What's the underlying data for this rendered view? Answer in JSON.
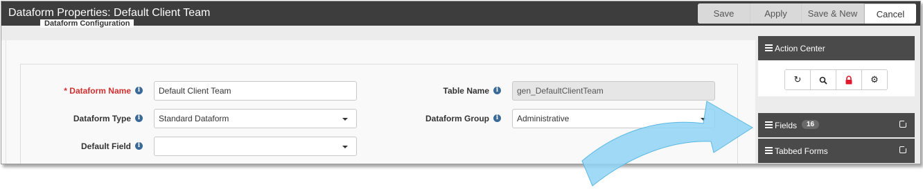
{
  "window": {
    "title": "Dataform Properties: Default Client Team",
    "buttons": {
      "save": "Save",
      "apply": "Apply",
      "save_new": "Save & New",
      "cancel": "Cancel"
    }
  },
  "form": {
    "section_title": "Dataform Configuration",
    "dataform_name": {
      "label": "* Dataform Name",
      "value": "Default Client Team"
    },
    "dataform_type": {
      "label": "Dataform Type",
      "value": "Standard Dataform"
    },
    "default_field": {
      "label": "Default Field",
      "value": ""
    },
    "table_name": {
      "label": "Table Name",
      "value": "gen_DefaultClientTeam"
    },
    "dataform_group": {
      "label": "Dataform Group",
      "value": "Administrative"
    }
  },
  "sidebar": {
    "action_center": {
      "label": "Action Center",
      "icons": [
        "refresh-icon",
        "search-icon",
        "lock-icon",
        "gear-icon"
      ]
    },
    "fields": {
      "label": "Fields",
      "count": "16"
    },
    "tabbed_forms": {
      "label": "Tabbed Forms"
    }
  },
  "colors": {
    "titlebar": "#3d3d3d",
    "required": "#d32f2f",
    "arrow": "#8fd3f4",
    "lock": "#e0192c"
  }
}
